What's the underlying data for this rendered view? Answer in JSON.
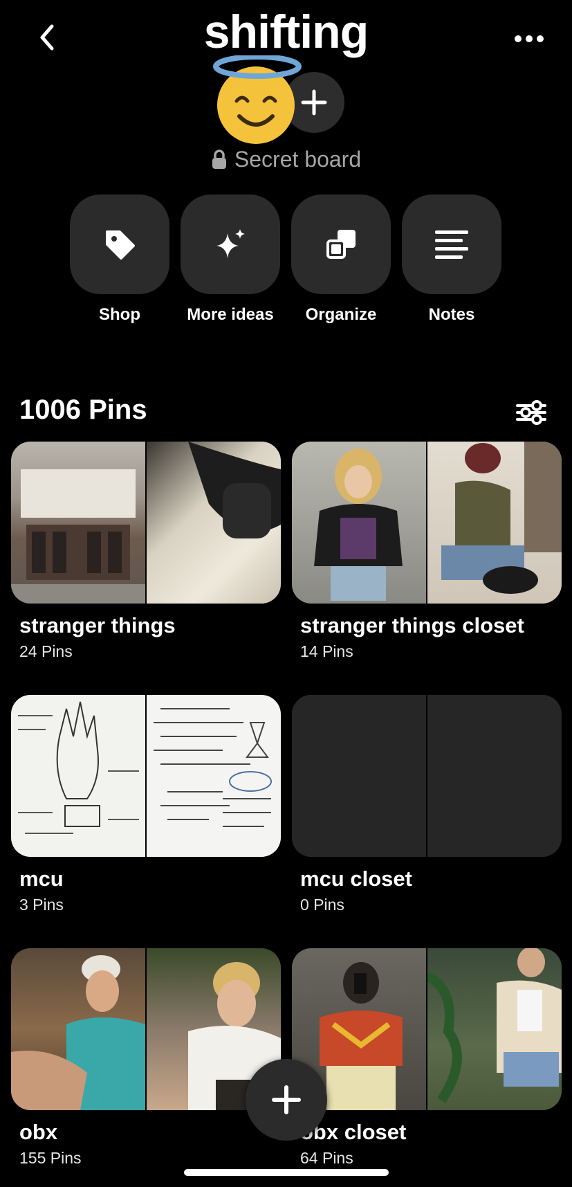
{
  "header": {
    "title": "shifting",
    "back_icon": "chevron-left-icon",
    "more_icon": "ellipsis-icon"
  },
  "board": {
    "avatar_icon": "smiling-face-with-halo-emoji",
    "add_collaborator_icon": "plus-icon",
    "privacy_icon": "lock-icon",
    "privacy_label": "Secret board"
  },
  "actions": [
    {
      "label": "Shop",
      "icon": "tag-icon"
    },
    {
      "label": "More ideas",
      "icon": "sparkle-icon"
    },
    {
      "label": "Organize",
      "icon": "organize-icon"
    },
    {
      "label": "Notes",
      "icon": "notes-icon"
    }
  ],
  "pins": {
    "count_label": "1006 Pins",
    "filter_icon": "sliders-icon"
  },
  "sections": [
    {
      "name": "stranger things",
      "count": "24 Pins",
      "has_cover": true
    },
    {
      "name": "stranger things closet",
      "count": "14 Pins",
      "has_cover": true
    },
    {
      "name": "mcu",
      "count": "3 Pins",
      "has_cover": true
    },
    {
      "name": "mcu closet",
      "count": "0 Pins",
      "has_cover": false
    },
    {
      "name": "obx",
      "count": "155 Pins",
      "has_cover": true
    },
    {
      "name": "obx closet",
      "count": "64 Pins",
      "has_cover": true
    }
  ],
  "fab_icon": "plus-icon",
  "colors": {
    "background": "#000000",
    "tile": "#2b2b2b",
    "muted_text": "#a6a6a6",
    "halo": "#6fa6d8",
    "emoji_face": "#f5c33b"
  }
}
